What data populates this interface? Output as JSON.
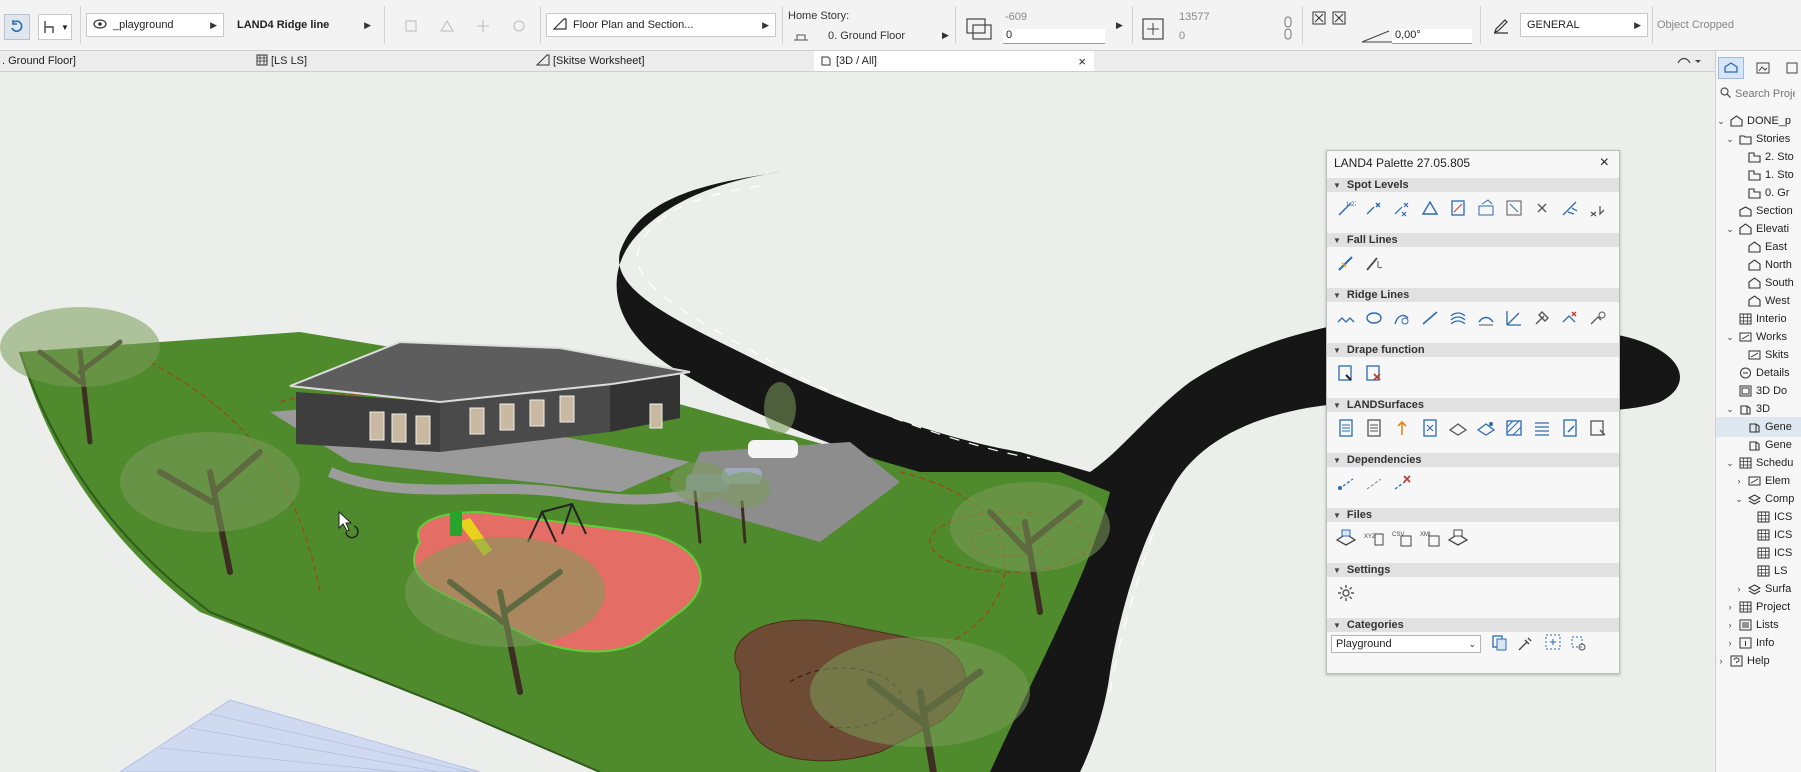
{
  "toolbar": {
    "layer_combo": "_playground",
    "tool_name": "LAND4 Ridge line",
    "view_combo": "Floor Plan and Section...",
    "home_story_label": "Home Story:",
    "home_story_value": "0. Ground Floor",
    "elev_top": "-609",
    "elev_value": "0",
    "size_top": "13577",
    "size_value": "0",
    "angle_value": "0,00°",
    "pen_combo": "GENERAL",
    "status": "Object Cropped"
  },
  "tabs": [
    {
      "label": ". Ground Floor]"
    },
    {
      "label": "[LS LS]"
    },
    {
      "label": "[Skitse Worksheet]"
    },
    {
      "label": "[3D / All]",
      "close": "×"
    }
  ],
  "palette": {
    "title": "LAND4 Palette 27.05.805",
    "close": "×",
    "sections": [
      {
        "name": "Spot Levels"
      },
      {
        "name": "Fall Lines"
      },
      {
        "name": "Ridge Lines"
      },
      {
        "name": "Drape function"
      },
      {
        "name": "LANDSurfaces"
      },
      {
        "name": "Dependencies"
      },
      {
        "name": "Files"
      },
      {
        "name": "Settings"
      },
      {
        "name": "Categories"
      }
    ],
    "category_value": "Playground"
  },
  "navigator": {
    "search_placeholder": "Search Proje",
    "items": [
      {
        "label": "DONE_p"
      },
      {
        "label": "Stories"
      },
      {
        "label": "2. Sto"
      },
      {
        "label": "1. Sto"
      },
      {
        "label": "0. Gr"
      },
      {
        "label": "Section"
      },
      {
        "label": "Elevati"
      },
      {
        "label": "East"
      },
      {
        "label": "North"
      },
      {
        "label": "South"
      },
      {
        "label": "West"
      },
      {
        "label": "Interio"
      },
      {
        "label": "Works"
      },
      {
        "label": "Skits"
      },
      {
        "label": "Details"
      },
      {
        "label": "3D Do"
      },
      {
        "label": "3D"
      },
      {
        "label": "Gene"
      },
      {
        "label": "Gene"
      },
      {
        "label": "Schedu"
      },
      {
        "label": "Elem"
      },
      {
        "label": "Comp"
      },
      {
        "label": "ICS"
      },
      {
        "label": "ICS"
      },
      {
        "label": "ICS"
      },
      {
        "label": "LS"
      },
      {
        "label": "Surfa"
      },
      {
        "label": "Project"
      },
      {
        "label": "Lists"
      },
      {
        "label": "Info"
      },
      {
        "label": "Help"
      }
    ]
  },
  "colors": {
    "grass": "#4f8a2c",
    "road": "#161616",
    "playground": "#e46e66",
    "accent": "#2b6cb0"
  }
}
